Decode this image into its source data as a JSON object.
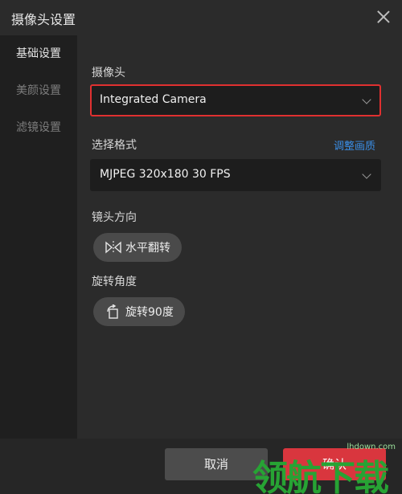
{
  "window": {
    "title": "摄像头设置"
  },
  "sidebar": {
    "items": [
      {
        "label": "基础设置",
        "active": true
      },
      {
        "label": "美颜设置",
        "active": false
      },
      {
        "label": "滤镜设置",
        "active": false
      }
    ]
  },
  "camera": {
    "label": "摄像头",
    "selected": "Integrated Camera"
  },
  "format": {
    "label": "选择格式",
    "adjust_link": "调整画质",
    "selected": "MJPEG 320x180 30 FPS"
  },
  "mirror": {
    "label": "镜头方向",
    "button": "水平翻转",
    "icon": "flip-horizontal-icon"
  },
  "rotate": {
    "label": "旋转角度",
    "button": "旋转90度",
    "icon": "rotate-icon"
  },
  "footer": {
    "cancel": "取消",
    "ok": "确认"
  },
  "watermark": {
    "text": "领航下载",
    "domain": "lhdown.com"
  },
  "colors": {
    "accent": "#d9363e",
    "link": "#3a8ee6",
    "highlight_border": "#e03030"
  }
}
